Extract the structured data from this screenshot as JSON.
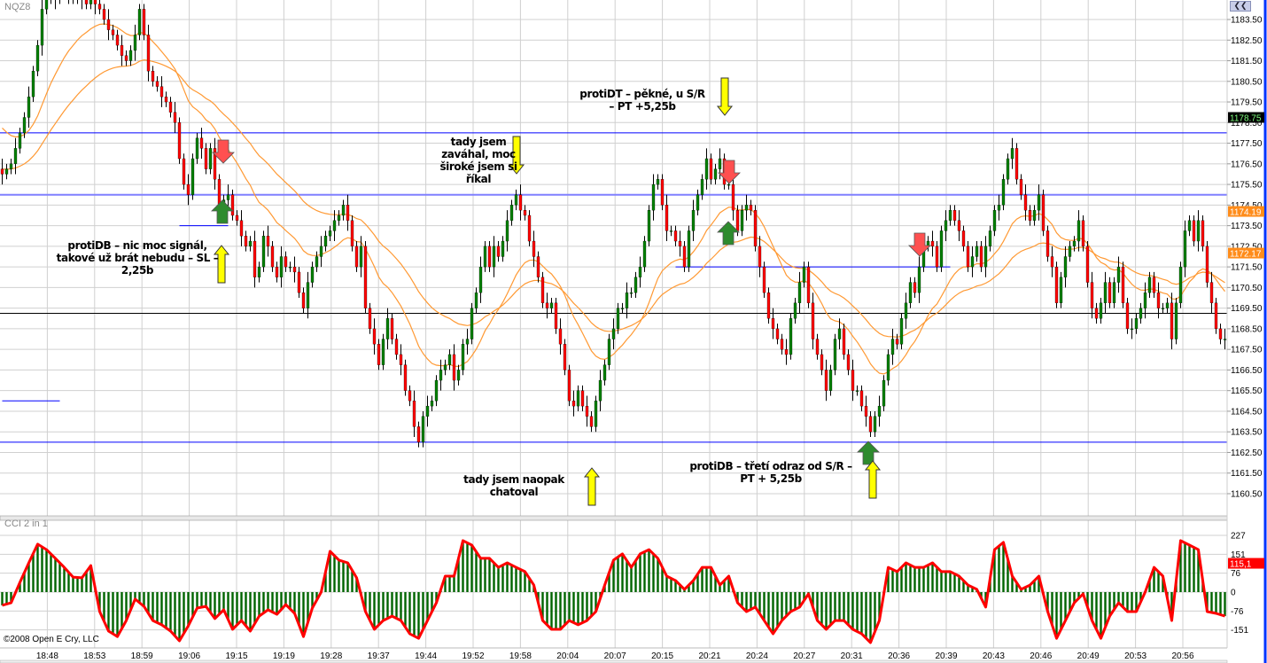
{
  "symbol": "NQZ8",
  "indicator_title": "CCI 2 in 1",
  "copyright": "©2008 Open E Cry, LLC",
  "collapse_button": "❮❮",
  "annotations": [
    {
      "id": "a1",
      "lines": [
        "protiDB – nic moc signál,",
        "takové už brát nebudu – SL –",
        "2,25b"
      ]
    },
    {
      "id": "a2",
      "lines": [
        "tady jsem",
        "zaváhal, moc",
        "široké jsem si",
        "říkal"
      ]
    },
    {
      "id": "a3",
      "lines": [
        "protiDT – pěkné, u S/R",
        "– PT +5,25b"
      ]
    },
    {
      "id": "a4",
      "lines": [
        "protiDB – třetí odraz od S/R –",
        "PT + 5,25b"
      ]
    },
    {
      "id": "a5",
      "lines": [
        "tady jsem naopak",
        "chatoval"
      ]
    }
  ],
  "colors": {
    "up": "#008000",
    "down": "#ff0000",
    "ma": "#ff9933",
    "level": "#0000ff",
    "level_light": "#8080ff",
    "cci_bar": "#006400",
    "cci_line": "#ff0000",
    "grid": "#d0d0d0"
  },
  "chart_data": {
    "type": "candlestick",
    "price_axis": {
      "ylim": [
        1160.5,
        1183.5
      ],
      "ticks": [
        "1183.50",
        "1182.50",
        "1181.50",
        "1180.50",
        "1179.50",
        "1178.50",
        "1177.50",
        "1176.50",
        "1175.50",
        "1174.50",
        "1173.50",
        "1172.50",
        "1171.50",
        "1170.50",
        "1169.50",
        "1168.50",
        "1167.50",
        "1166.50",
        "1165.50",
        "1164.50",
        "1163.50",
        "1162.50",
        "1161.50",
        "1160.50"
      ]
    },
    "price_markers": [
      {
        "label": "1178.75",
        "value": 1178.75,
        "style": "black"
      },
      {
        "label": "1174.19",
        "value": 1174.19,
        "style": "orange"
      },
      {
        "label": "1172.17",
        "value": 1172.17,
        "style": "orange"
      }
    ],
    "time_ticks": [
      "18:48",
      "18:53",
      "18:59",
      "19:06",
      "19:15",
      "19:19",
      "19:28",
      "19:37",
      "19:44",
      "19:52",
      "19:58",
      "20:04",
      "20:07",
      "20:15",
      "20:21",
      "20:24",
      "20:27",
      "20:31",
      "20:36",
      "20:39",
      "20:43",
      "20:46",
      "20:49",
      "20:53",
      "20:56"
    ],
    "wick_pts": 0.5,
    "closes": [
      1176.0,
      1176.25,
      1176.5,
      1177.25,
      1178.0,
      1178.75,
      1179.75,
      1181.0,
      1182.25,
      1184.0,
      1184.5,
      1184.75,
      1184.5,
      1184.75,
      1185.0,
      1184.75,
      1184.5,
      1184.75,
      1184.5,
      1184.25,
      1184.5,
      1184.25,
      1184.0,
      1183.5,
      1183.0,
      1182.75,
      1182.25,
      1181.75,
      1181.5,
      1182.0,
      1182.75,
      1184.0,
      1182.75,
      1181.0,
      1180.5,
      1180.25,
      1179.75,
      1179.5,
      1179.0,
      1178.5,
      1176.75,
      1175.5,
      1175.0,
      1176.75,
      1177.75,
      1177.25,
      1176.25,
      1177.25,
      1175.75,
      1174.25,
      1174.75,
      1175.0,
      1174.0,
      1173.75,
      1173.0,
      1172.5,
      1172.75,
      1171.0,
      1171.5,
      1173.0,
      1172.5,
      1171.5,
      1171.0,
      1172.0,
      1171.5,
      1171.5,
      1171.25,
      1170.25,
      1169.5,
      1170.75,
      1171.5,
      1172.0,
      1172.5,
      1173.0,
      1173.25,
      1173.75,
      1174.0,
      1174.5,
      1173.75,
      1172.5,
      1171.5,
      1172.5,
      1169.5,
      1168.5,
      1167.75,
      1166.75,
      1168.0,
      1169.0,
      1168.0,
      1167.25,
      1166.75,
      1165.5,
      1165.0,
      1163.75,
      1163.0,
      1164.25,
      1164.75,
      1165.0,
      1166.0,
      1166.5,
      1166.75,
      1167.25,
      1166.0,
      1166.5,
      1167.75,
      1168.0,
      1169.5,
      1170.25,
      1171.5,
      1172.5,
      1171.5,
      1172.5,
      1172.0,
      1172.75,
      1173.75,
      1174.5,
      1175.0,
      1174.25,
      1174.0,
      1172.75,
      1172.0,
      1171.0,
      1169.75,
      1169.5,
      1169.75,
      1168.5,
      1167.75,
      1166.5,
      1165.0,
      1164.75,
      1165.5,
      1164.75,
      1164.25,
      1163.75,
      1165.0,
      1166.0,
      1166.75,
      1168.0,
      1168.5,
      1169.5,
      1169.5,
      1170.25,
      1170.25,
      1171.0,
      1171.5,
      1172.75,
      1174.25,
      1175.5,
      1175.75,
      1174.5,
      1173.25,
      1173.25,
      1172.75,
      1172.5,
      1171.5,
      1173.25,
      1174.25,
      1175.0,
      1175.75,
      1176.75,
      1175.75,
      1176.25,
      1176.75,
      1175.5,
      1175.5,
      1174.25,
      1173.25,
      1174.25,
      1174.5,
      1174.25,
      1172.5,
      1171.5,
      1170.25,
      1169.0,
      1168.5,
      1168.0,
      1167.5,
      1167.25,
      1169.0,
      1169.75,
      1170.75,
      1171.5,
      1169.75,
      1168.0,
      1167.25,
      1166.5,
      1165.5,
      1166.5,
      1168.0,
      1168.5,
      1167.25,
      1166.5,
      1165.5,
      1165.5,
      1164.75,
      1164.25,
      1163.5,
      1164.25,
      1164.75,
      1166.0,
      1167.25,
      1168.0,
      1167.75,
      1169.0,
      1169.75,
      1170.75,
      1170.25,
      1171.5,
      1172.5,
      1172.75,
      1172.5,
      1171.5,
      1173.25,
      1173.75,
      1174.25,
      1173.75,
      1173.25,
      1172.5,
      1171.5,
      1172.0,
      1172.5,
      1171.5,
      1172.5,
      1173.25,
      1174.25,
      1174.5,
      1175.75,
      1176.75,
      1177.25,
      1175.75,
      1175.0,
      1174.25,
      1173.75,
      1174.25,
      1175.0,
      1173.25,
      1172.0,
      1171.5,
      1169.75,
      1171.0,
      1172.0,
      1172.5,
      1172.75,
      1173.75,
      1172.5,
      1170.75,
      1169.5,
      1169.0,
      1169.75,
      1170.75,
      1169.75,
      1170.75,
      1171.5,
      1169.75,
      1168.5,
      1168.5,
      1169.0,
      1169.5,
      1170.25,
      1171.0,
      1170.25,
      1169.5,
      1169.5,
      1169.75,
      1168.0,
      1169.75,
      1171.5,
      1173.25,
      1173.75,
      1172.75,
      1173.75,
      1172.5,
      1170.75,
      1169.75,
      1168.5,
      1168.0,
      1168.0
    ],
    "moving_averages": [
      {
        "type": "EMA",
        "period": 18,
        "seed": 1178.5
      },
      {
        "type": "EMA",
        "period": 40,
        "seed": 1176.25
      }
    ],
    "levels": [
      {
        "price": 1178.0,
        "style": "solid"
      },
      {
        "price": 1175.0,
        "style": "light"
      },
      {
        "price": 1169.25,
        "style": "black"
      },
      {
        "price": 1163.0,
        "style": "solid"
      }
    ],
    "segments": [
      {
        "price": 1173.5,
        "from_bar": 40,
        "to_bar": 51
      },
      {
        "price": 1165.0,
        "from_bar": 0,
        "to_bar": 13
      },
      {
        "price": 1171.5,
        "from_bar": 152,
        "to_bar": 214
      }
    ],
    "cci": {
      "title": "CCI 2 in 1",
      "ylim": [
        -200,
        240
      ],
      "ticks": [
        "227",
        "151",
        "76",
        "0",
        "-76",
        "-151"
      ],
      "tick_values": [
        227,
        151,
        76,
        0,
        -76,
        -151
      ],
      "last_label": "115,1",
      "last_value": 115.1,
      "samples_per_bar": 0.5,
      "values": [
        -53,
        -43,
        39,
        117,
        192,
        170,
        135,
        99,
        60,
        57,
        106,
        -78,
        -156,
        -178,
        -114,
        -28,
        -57,
        -114,
        -131,
        -156,
        -195,
        -135,
        -64,
        -57,
        -106,
        -71,
        -149,
        -114,
        -156,
        -96,
        -71,
        -89,
        -50,
        -85,
        -178,
        -64,
        0,
        163,
        128,
        117,
        57,
        -78,
        -149,
        -114,
        -96,
        -114,
        -167,
        -185,
        -114,
        -43,
        64,
        64,
        206,
        188,
        135,
        135,
        99,
        117,
        99,
        82,
        28,
        -114,
        -149,
        -149,
        -114,
        -131,
        -114,
        -78,
        28,
        128,
        153,
        99,
        153,
        170,
        135,
        64,
        46,
        11,
        46,
        99,
        99,
        28,
        64,
        -43,
        -78,
        -60,
        -114,
        -167,
        -114,
        -78,
        -60,
        -7,
        -114,
        -149,
        -114,
        -114,
        -149,
        -167,
        -202,
        -114,
        99,
        82,
        117,
        99,
        99,
        117,
        82,
        82,
        64,
        28,
        11,
        -60,
        170,
        199,
        64,
        11,
        28,
        64,
        -78,
        -185,
        -114,
        -43,
        -7,
        -114,
        -185,
        -96,
        -43,
        -78,
        -78,
        0,
        99,
        64,
        -114,
        206,
        188,
        170,
        -78,
        -85,
        -96
      ]
    }
  }
}
